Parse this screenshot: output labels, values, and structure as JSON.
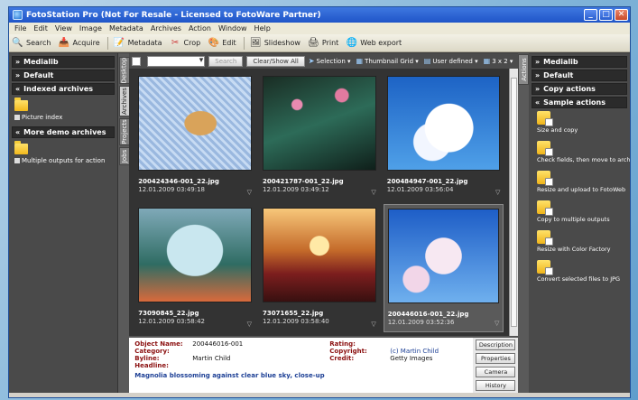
{
  "window": {
    "title": "FotoStation Pro (Not For Resale - Licensed to FotoWare Partner)"
  },
  "menu": [
    "File",
    "Edit",
    "View",
    "Image",
    "Metadata",
    "Archives",
    "Action",
    "Window",
    "Help"
  ],
  "toolbar": [
    {
      "label": "Search",
      "icon": "search-icon"
    },
    {
      "label": "Acquire",
      "icon": "acquire-icon"
    },
    {
      "label": "Metadata",
      "icon": "metadata-icon"
    },
    {
      "label": "Crop",
      "icon": "crop-icon"
    },
    {
      "label": "Edit",
      "icon": "edit-icon"
    },
    {
      "label": "Slideshow",
      "icon": "slideshow-icon"
    },
    {
      "label": "Print",
      "icon": "print-icon"
    },
    {
      "label": "Web export",
      "icon": "globe-icon"
    }
  ],
  "left_tabs": [
    "Desktop",
    "Archives",
    "Projects",
    "Jobs"
  ],
  "left_panel": {
    "medialib": "Medialib",
    "default": "Default",
    "indexed": {
      "title": "Indexed archives",
      "item": "Picture index"
    },
    "demo": {
      "title": "More demo archives",
      "item": "Multiple outputs for action"
    }
  },
  "browser_toolbar": {
    "search_button": "Search",
    "clear_button": "Clear/Show All",
    "selection": "Selection",
    "thumbnail_grid": "Thumbnail Grid",
    "user_defined": "User defined",
    "grid_size": "3 x 2"
  },
  "thumbnails": [
    {
      "file": "200424346-001_22.jpg",
      "date": "12.01.2009 03:49:18"
    },
    {
      "file": "200421787-001_22.jpg",
      "date": "12.01.2009 03:49:12"
    },
    {
      "file": "200484947-001_22.jpg",
      "date": "12.01.2009 03:56:04"
    },
    {
      "file": "73090845_22.jpg",
      "date": "12.01.2009 03:58:42"
    },
    {
      "file": "73071655_22.jpg",
      "date": "12.01.2009 03:58:40"
    },
    {
      "file": "200446016-001_22.jpg",
      "date": "12.01.2009 03:52:36"
    }
  ],
  "metadata": {
    "object_name_label": "Object Name:",
    "object_name": "200446016-001",
    "category_label": "Category:",
    "byline_label": "Byline:",
    "byline": "Martin Child",
    "headline_label": "Headline:",
    "rating_label": "Rating:",
    "copyright_label": "Copyright:",
    "copyright": "(c) Martin Child",
    "credit_label": "Credit:",
    "credit": "Getty Images",
    "description": "Magnolia blossoming against clear blue sky, close-up"
  },
  "meta_buttons": [
    "Description",
    "Properties",
    "Camera",
    "History"
  ],
  "right_tab": "Actions",
  "right_panel": {
    "medialib": "Medialib",
    "default": "Default",
    "copy": "Copy actions",
    "sample": "Sample actions",
    "actions": [
      "Size and copy",
      "Check fields, then move to archive",
      "Resize and upload to FotoWeb",
      "Copy to multiple outputs",
      "Resize with Color Factory",
      "Convert selected files to JPG"
    ]
  }
}
